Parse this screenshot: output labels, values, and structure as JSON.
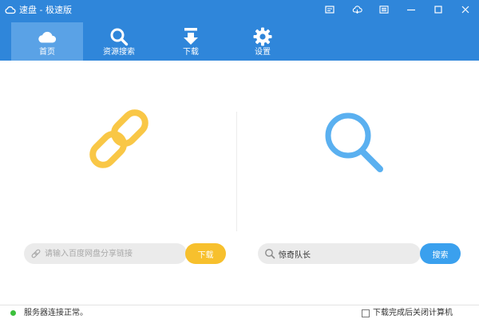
{
  "app": {
    "title": "速盘 - 极速版"
  },
  "titlebar_icons": [
    "feedback-icon",
    "cloud-sync-icon",
    "menu-icon",
    "minimize-icon",
    "maximize-icon",
    "close-icon"
  ],
  "nav": {
    "items": [
      {
        "label": "首页",
        "icon": "cloud-icon",
        "active": true
      },
      {
        "label": "资源搜索",
        "icon": "search-icon",
        "active": false
      },
      {
        "label": "下载",
        "icon": "download-icon",
        "active": false
      },
      {
        "label": "设置",
        "icon": "gear-icon",
        "active": false
      }
    ]
  },
  "link_panel": {
    "placeholder": "请输入百度网盘分享链接",
    "value": "",
    "button_label": "下载",
    "icon": "link-icon"
  },
  "search_panel": {
    "placeholder": "",
    "value": "惊奇队长",
    "button_label": "搜索",
    "icon": "search-icon"
  },
  "status": {
    "text": "服务器连接正常。",
    "indicator_color": "#3cc03c",
    "shutdown_label": "下载完成后关闭计算机",
    "shutdown_checked": false
  },
  "colors": {
    "header": "#2f86da",
    "nav_active": "#5aa2e6",
    "download_button": "#f7c02d",
    "search_button": "#3aa0ee",
    "link_icon": "#f9c746",
    "search_icon": "#5ab0f0"
  }
}
